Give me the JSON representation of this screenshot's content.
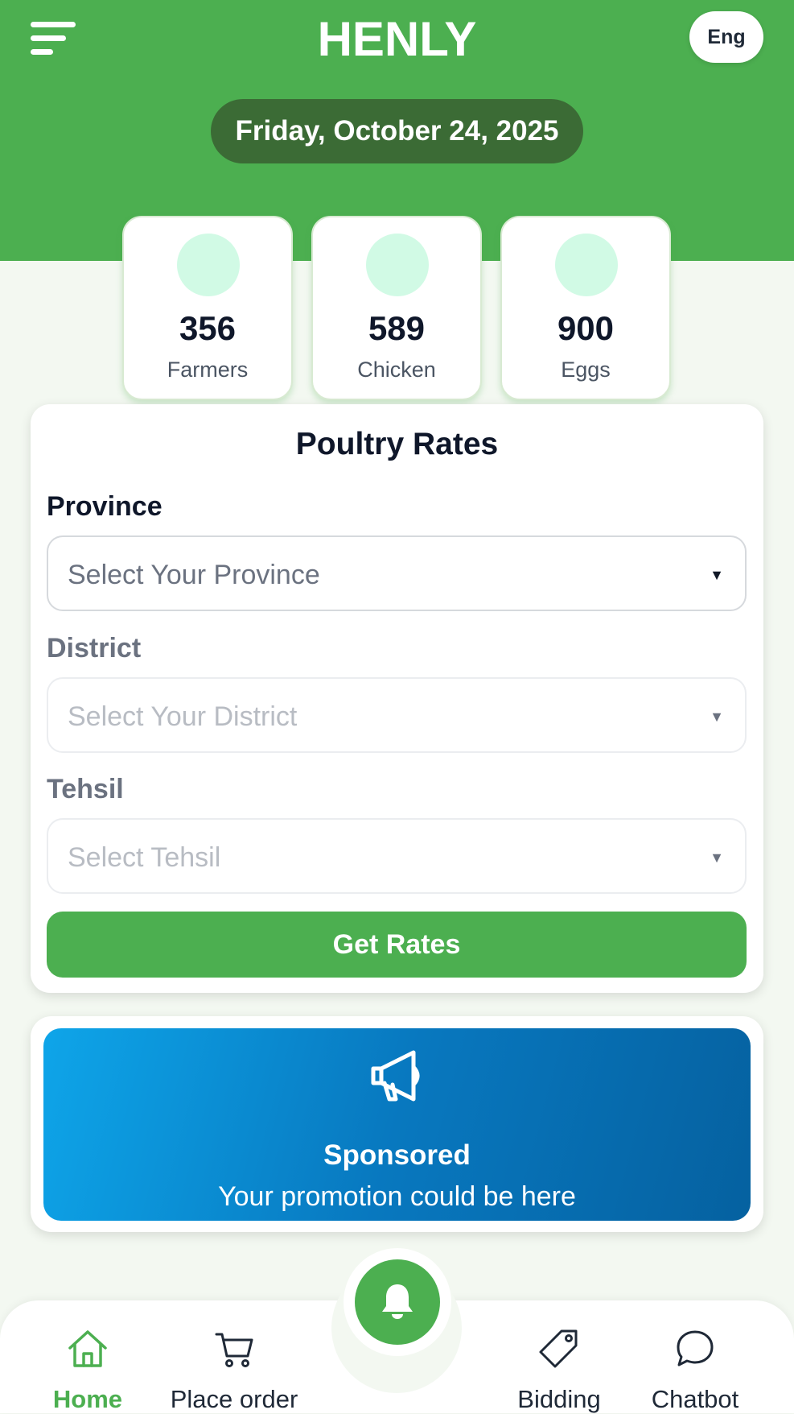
{
  "header": {
    "app_title": "HENLY",
    "language_label": "Eng",
    "date": "Friday, October 24, 2025",
    "menu_icon": "menu-icon"
  },
  "stats": [
    {
      "value": "356",
      "label": "Farmers"
    },
    {
      "value": "589",
      "label": "Chicken"
    },
    {
      "value": "900",
      "label": "Eggs"
    }
  ],
  "rates": {
    "title": "Poultry Rates",
    "province_label": "Province",
    "province_placeholder": "Select Your Province",
    "district_label": "District",
    "district_placeholder": "Select Your District",
    "tehsil_label": "Tehsil",
    "tehsil_placeholder": "Select Tehsil",
    "button_label": "Get Rates"
  },
  "promo": {
    "title": "Sponsored",
    "subtitle": "Your promotion could be here",
    "icon": "megaphone-icon"
  },
  "nav": {
    "items": [
      {
        "label": "Home",
        "icon": "home-icon",
        "active": true
      },
      {
        "label": "Place order",
        "icon": "cart-icon",
        "active": false
      },
      {
        "label": "Bidding",
        "icon": "tag-icon",
        "active": false
      },
      {
        "label": "Chatbot",
        "icon": "chat-icon",
        "active": false
      }
    ],
    "fab_icon": "bell-icon"
  },
  "colors": {
    "primary_green": "#4caf50",
    "date_pill": "#3b6b35",
    "stat_circle": "#d1fae5",
    "promo_start": "#0ea5e9",
    "promo_end": "#0561a0",
    "background": "#f3f8f1"
  }
}
